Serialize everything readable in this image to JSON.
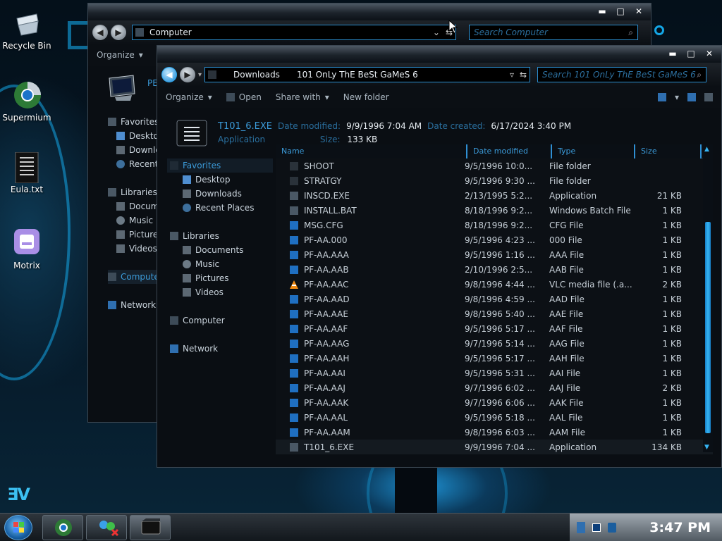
{
  "desktop": {
    "icons": [
      {
        "label": "Recycle Bin",
        "icon": "recycle-bin-icon"
      },
      {
        "label": "Supermium",
        "icon": "browser-icon"
      },
      {
        "label": "Eula.txt",
        "icon": "text-file-icon"
      },
      {
        "label": "Motrix",
        "icon": "download-manager-icon"
      }
    ]
  },
  "back_window": {
    "address": "Computer",
    "search_placeholder": "Search Computer",
    "organize": "Organize",
    "pc_label": "PE",
    "nav": {
      "favorites": "Favorites",
      "fav_items": [
        "Deskto",
        "Downlo",
        "Recent"
      ],
      "libraries": "Libraries",
      "lib_items": [
        "Docum",
        "Music",
        "Picture",
        "Videos"
      ],
      "computer": "Compute",
      "network": "Network"
    }
  },
  "front_window": {
    "address_parts": [
      "Downloads",
      "101 OnLy ThE BeSt GaMeS 6"
    ],
    "search_placeholder": "Search 101 OnLy ThE BeSt GaMeS 6",
    "commands": {
      "organize": "Organize",
      "open": "Open",
      "share_with": "Share with",
      "new_folder": "New folder"
    },
    "details": {
      "name": "T101_6.EXE",
      "modified_label": "Date modified:",
      "modified_value": "9/9/1996 7:04 AM",
      "created_label": "Date created:",
      "created_value": "6/17/2024 3:40 PM",
      "type": "Application",
      "size_label": "Size:",
      "size_value": "133 KB"
    },
    "nav": {
      "favorites": "Favorites",
      "fav_items": [
        "Desktop",
        "Downloads",
        "Recent Places"
      ],
      "libraries": "Libraries",
      "lib_items": [
        "Documents",
        "Music",
        "Pictures",
        "Videos"
      ],
      "computer": "Computer",
      "network": "Network"
    },
    "columns": [
      "Name",
      "Date modified",
      "Type",
      "Size"
    ],
    "rows": [
      {
        "name": "SHOOT",
        "date": "9/5/1996 10:0...",
        "type": "File folder",
        "size": "",
        "icon": "folder-icon"
      },
      {
        "name": "STRATGY",
        "date": "9/5/1996 9:30 ...",
        "type": "File folder",
        "size": "",
        "icon": "folder-icon"
      },
      {
        "name": "INSCD.EXE",
        "date": "2/13/1995 5:2...",
        "type": "Application",
        "size": "21 KB",
        "icon": "app-icon"
      },
      {
        "name": "INSTALL.BAT",
        "date": "8/18/1996 9:2...",
        "type": "Windows Batch File",
        "size": "1 KB",
        "icon": "batch-icon"
      },
      {
        "name": "MSG.CFG",
        "date": "8/18/1996 9:2...",
        "type": "CFG File",
        "size": "1 KB",
        "icon": "file-icon"
      },
      {
        "name": "PF-AA.000",
        "date": "9/5/1996 4:23 ...",
        "type": "000 File",
        "size": "1 KB",
        "icon": "file-icon"
      },
      {
        "name": "PF-AA.AAA",
        "date": "9/5/1996 1:16 ...",
        "type": "AAA File",
        "size": "1 KB",
        "icon": "file-icon"
      },
      {
        "name": "PF-AA.AAB",
        "date": "2/10/1996 2:5...",
        "type": "AAB File",
        "size": "1 KB",
        "icon": "file-icon"
      },
      {
        "name": "PF-AA.AAC",
        "date": "9/8/1996 4:44 ...",
        "type": "VLC media file (.a...",
        "size": "2 KB",
        "icon": "vlc-icon"
      },
      {
        "name": "PF-AA.AAD",
        "date": "9/8/1996 4:59 ...",
        "type": "AAD File",
        "size": "1 KB",
        "icon": "file-icon"
      },
      {
        "name": "PF-AA.AAE",
        "date": "9/8/1996 5:40 ...",
        "type": "AAE File",
        "size": "1 KB",
        "icon": "file-icon"
      },
      {
        "name": "PF-AA.AAF",
        "date": "9/5/1996 5:17 ...",
        "type": "AAF File",
        "size": "1 KB",
        "icon": "file-icon"
      },
      {
        "name": "PF-AA.AAG",
        "date": "9/7/1996 5:14 ...",
        "type": "AAG File",
        "size": "1 KB",
        "icon": "file-icon"
      },
      {
        "name": "PF-AA.AAH",
        "date": "9/5/1996 5:17 ...",
        "type": "AAH File",
        "size": "1 KB",
        "icon": "file-icon"
      },
      {
        "name": "PF-AA.AAI",
        "date": "9/5/1996 5:31 ...",
        "type": "AAI File",
        "size": "1 KB",
        "icon": "file-icon"
      },
      {
        "name": "PF-AA.AAJ",
        "date": "9/7/1996 6:02 ...",
        "type": "AAJ File",
        "size": "2 KB",
        "icon": "file-icon"
      },
      {
        "name": "PF-AA.AAK",
        "date": "9/7/1996 6:06 ...",
        "type": "AAK File",
        "size": "1 KB",
        "icon": "file-icon"
      },
      {
        "name": "PF-AA.AAL",
        "date": "9/5/1996 5:18 ...",
        "type": "AAL File",
        "size": "1 KB",
        "icon": "file-icon"
      },
      {
        "name": "PF-AA.AAM",
        "date": "9/8/1996 6:03 ...",
        "type": "AAM File",
        "size": "1 KB",
        "icon": "file-icon"
      },
      {
        "name": "T101_6.EXE",
        "date": "9/9/1996 7:04 ...",
        "type": "Application",
        "size": "134 KB",
        "icon": "app-icon"
      }
    ]
  },
  "taskbar": {
    "clock": "3:47 PM",
    "pinned": [
      "browser-icon",
      "network-app-icon",
      "explorer-icon"
    ]
  },
  "colors": {
    "accent": "#2b8ed0",
    "accent_light": "#3cc0f2",
    "window_bg": "#0a0e13"
  }
}
